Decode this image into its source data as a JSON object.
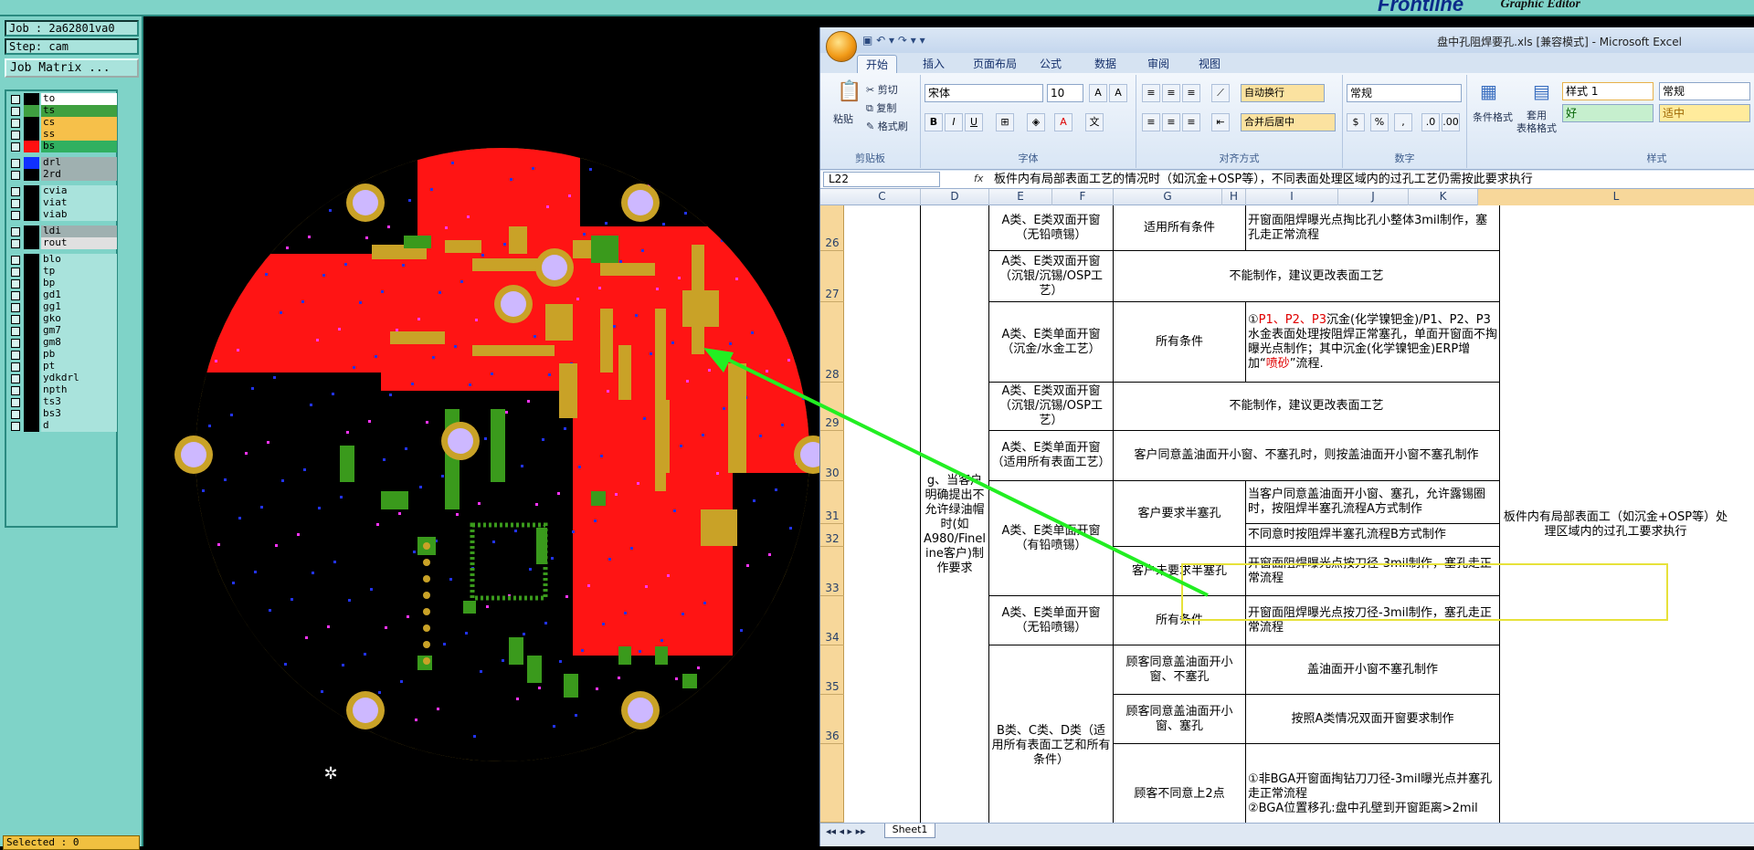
{
  "app": {
    "graphic_editor": "Graphic Editor",
    "logo_text": "Frontline"
  },
  "left_panel": {
    "job": "Job : 2a62801va0",
    "step": "Step: cam",
    "job_matrix": "Job Matrix ...",
    "selected": "Selected : 0"
  },
  "layers": [
    {
      "name": "to",
      "color": "#000000",
      "fill": "#ffffff"
    },
    {
      "name": "ts",
      "color": "#3fa040",
      "fill": "#3fa040"
    },
    {
      "name": "cs",
      "color": "#000000",
      "fill": "#f6c04a"
    },
    {
      "name": "ss",
      "color": "#000000",
      "fill": "#f6c04a"
    },
    {
      "name": "bs",
      "color": "#ff1010",
      "fill": "#30b060"
    },
    {
      "name": "drl",
      "color": "#1030ff",
      "fill": "#9fb0b0"
    },
    {
      "name": "2rd",
      "color": "#000000",
      "fill": "#9fb0b0"
    },
    {
      "name": "cvia",
      "color": "#000000",
      "fill": "#a9e3dc"
    },
    {
      "name": "viat",
      "color": "#000000",
      "fill": "#a9e3dc"
    },
    {
      "name": "viab",
      "color": "#000000",
      "fill": "#a9e3dc"
    },
    {
      "name": "ldi",
      "color": "#000000",
      "fill": "#9fb0b0"
    },
    {
      "name": "rout",
      "color": "#000000",
      "fill": "#e0e0e0"
    },
    {
      "name": "blo",
      "color": "#000000",
      "fill": "#a9e3dc"
    },
    {
      "name": "tp",
      "color": "#000000",
      "fill": "#a9e3dc"
    },
    {
      "name": "bp",
      "color": "#000000",
      "fill": "#a9e3dc"
    },
    {
      "name": "gd1",
      "color": "#000000",
      "fill": "#a9e3dc"
    },
    {
      "name": "gg1",
      "color": "#000000",
      "fill": "#a9e3dc"
    },
    {
      "name": "gko",
      "color": "#000000",
      "fill": "#a9e3dc"
    },
    {
      "name": "gm7",
      "color": "#000000",
      "fill": "#a9e3dc"
    },
    {
      "name": "gm8",
      "color": "#000000",
      "fill": "#a9e3dc"
    },
    {
      "name": "pb",
      "color": "#000000",
      "fill": "#a9e3dc"
    },
    {
      "name": "pt",
      "color": "#000000",
      "fill": "#a9e3dc"
    },
    {
      "name": "ydkdrl",
      "color": "#000000",
      "fill": "#a9e3dc"
    },
    {
      "name": "npth",
      "color": "#000000",
      "fill": "#a9e3dc"
    },
    {
      "name": "ts3",
      "color": "#000000",
      "fill": "#a9e3dc"
    },
    {
      "name": "bs3",
      "color": "#000000",
      "fill": "#a9e3dc"
    },
    {
      "name": "d",
      "color": "#000000",
      "fill": "#a9e3dc"
    }
  ],
  "excel": {
    "title": "盘中孔阻焊要孔.xls [兼容模式] - Microsoft Excel",
    "tabs": [
      "开始",
      "插入",
      "页面布局",
      "公式",
      "数据",
      "审阅",
      "视图"
    ],
    "ribbon": {
      "paste": "粘贴",
      "cut": "剪切",
      "copy": "复制",
      "format_painter": "格式刷",
      "clipboard": "剪贴板",
      "font_name": "宋体",
      "font_size": "10",
      "font_group": "字体",
      "wrap": "自动换行",
      "merge": "合并后居中",
      "align_group": "对齐方式",
      "number_format": "常规",
      "number_group": "数字",
      "cond_format": "条件格式",
      "table_format": "套用\n表格格式",
      "style_group": "样式",
      "style1": "样式 1",
      "style_normal": "常规",
      "style_good": "好",
      "style_neutral": "适中"
    },
    "name_box": "L22",
    "formula": "板件内有局部表面工艺的情况时（如沉金+OSP等），不同表面处理区域内的过孔工艺仍需按此要求执行",
    "columns": [
      "C",
      "D",
      "E",
      "F",
      "G",
      "H",
      "I",
      "J",
      "K",
      "L"
    ],
    "rows": [
      "26",
      "27",
      "28",
      "29",
      "30",
      "31",
      "32",
      "33",
      "34",
      "35",
      "36",
      ""
    ],
    "sheet_tab": "Sheet1",
    "cells": {
      "d_merge": "g、当客户明确提出不允许绿油帽时(如A980/Finel ine客户)制作要求",
      "l_merge": "板件内有局部表面工（如沉金+OSP等）处理区域内的过孔工要求执行",
      "e26": "A类、E类双面开窗（无铅喷锡）",
      "g26": "适用所有条件",
      "i26": "开窗面阻焊曝光点掏比孔小整体3mil制作，塞孔走正常流程",
      "e27": "A类、E类双面开窗（沉银/沉锡/OSP工艺）",
      "g27": "不能制作，建议更改表面工艺",
      "e28": "A类、E类单面开窗（沉金/水金工艺）",
      "g28": "所有条件",
      "i28_a": "①",
      "i28_red": "P1、P2、P3",
      "i28_b": "沉金(化学镍钯金)/P1、P2、P3水金表面处理按阻焊正常塞孔，单面开窗面不掏曝光点制作；其中沉金(化学镍钯金)ERP增加“",
      "i28_red2": "喷砂",
      "i28_c": "”流程.",
      "e29": "A类、E类双面开窗（沉银/沉锡/OSP工艺）",
      "g29": "不能制作，建议更改表面工艺",
      "e30": "A类、E类单面开窗（适用所有表面工艺）",
      "g30": "客户同意盖油面开小窗、不塞孔时，则按盖油面开小窗不塞孔制作",
      "e31": "A类、E类单面开窗（有铅喷锡）",
      "g31": "客户要求半塞孔",
      "i31": "当客户同意盖油面开小窗、塞孔，允许露锡圈时，按阻焊半塞孔流程A方式制作",
      "i32": "不同意时按阻焊半塞孔流程B方式制作",
      "g33": "客户未要求半塞孔",
      "i33": "开窗面阻焊曝光点按刀径-3mil制作，塞孔走正常流程",
      "e34": "A类、E类单面开窗（无铅喷锡）",
      "g34": "所有条件",
      "i34": "开窗面阻焊曝光点按刀径-3mil制作，塞孔走正常流程",
      "e35": "B类、C类、D类（适用所有表面工艺和所有条件）",
      "g35": "顾客同意盖油面开小窗、不塞孔",
      "i35": "盖油面开小窗不塞孔制作",
      "g36": "顾客同意盖油面开小窗、塞孔",
      "i36": "按照A类情况双面开窗要求制作",
      "g37": "顾客不同意上2点",
      "i37": "①非BGA开窗面掏钻刀刀径-3mil曝光点并塞孔走正常流程\n②BGA位置移孔:盘中孔壁到开窗距离>2mil"
    }
  },
  "colors": {
    "copper": "#ff1414",
    "pad": "#c9a227",
    "green": "#3a9a1c",
    "via": "#2233ee",
    "drill_pad": "#cdb8ff",
    "outline": "#e0b020",
    "arrow": "#22ee22",
    "highlight": "#e7e23a"
  }
}
